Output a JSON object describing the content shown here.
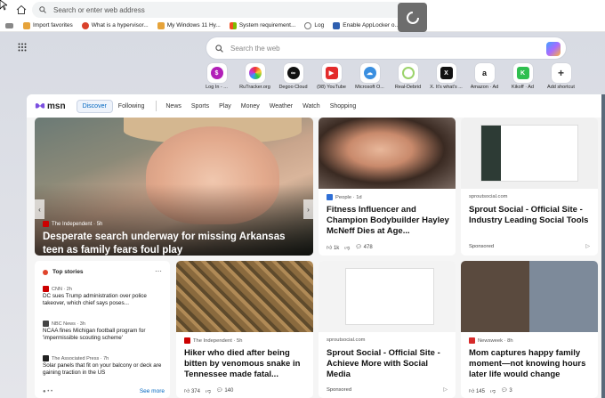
{
  "address_bar": {
    "placeholder": "Search or enter web address"
  },
  "bookmarks": [
    {
      "label": "Import favorites",
      "color": "#e6a33a"
    },
    {
      "label": "What is a hypervisor...",
      "color": "#d9412b"
    },
    {
      "label": "My Windows 11 Hy...",
      "color": "#e6a33a"
    },
    {
      "label": "System requirement...",
      "color": "#3c8d3c"
    },
    {
      "label": "Log",
      "color": "#777777"
    },
    {
      "label": "Enable AppLocker o...",
      "color": "#2e5fb0"
    }
  ],
  "search": {
    "placeholder": "Search the web"
  },
  "shortcuts": [
    {
      "label": "Log In - ...",
      "color": "#b21fb8",
      "glyph": "$"
    },
    {
      "label": "RuTracker.org",
      "color": "#f0f0f0",
      "glyph": "✶"
    },
    {
      "label": "Degoo Cloud",
      "color": "#111111",
      "glyph": "∞"
    },
    {
      "label": "(98) YouTube",
      "color": "#e32b2b",
      "glyph": "▶"
    },
    {
      "label": "Microsoft O...",
      "color": "#3a8fe0",
      "glyph": "☁"
    },
    {
      "label": "Real-Debrid",
      "color": "#f4f4f4",
      "glyph": "◌"
    },
    {
      "label": "X. It's what's ...",
      "color": "#111111",
      "glyph": "X"
    },
    {
      "label": "Amazon · Ad",
      "color": "#ffffff",
      "glyph": "a"
    },
    {
      "label": "Kikoff · Ad",
      "color": "#2fbf4f",
      "glyph": "K"
    },
    {
      "label": "Add shortcut",
      "color": "#ffffff",
      "glyph": "+"
    }
  ],
  "msn": {
    "logo": "msn",
    "tabs_primary": [
      "Discover",
      "Following"
    ],
    "tabs": [
      "News",
      "Sports",
      "Play",
      "Money",
      "Weather",
      "Watch",
      "Shopping"
    ]
  },
  "hero": {
    "source": "The Independent · 5h",
    "title": "Desperate search underway for missing Arkansas teen as family fears foul play",
    "likes": "78",
    "comments": "7"
  },
  "card2": {
    "source": "People · 1d",
    "title": "Fitness Influencer and Champion Bodybuilder Hayley McNeff Dies at Age...",
    "likes": "1k",
    "comments": "478"
  },
  "card3": {
    "source": "sproutsocial.com",
    "title": "Sprout Social - Official Site - Industry Leading Social Tools",
    "sponsored": "Sponsored"
  },
  "top_stories": {
    "heading": "Top stories",
    "items": [
      {
        "source": "CNN · 2h",
        "text": "DC sues Trump administration over police takeover, which chief says poses...",
        "color": "#cc0000"
      },
      {
        "source": "NBC News · 3h",
        "text": "NCAA fines Michigan football program for 'impermissible scouting scheme'",
        "color": "#222222"
      },
      {
        "source": "The Associated Press · 7h",
        "text": "Solar panels that fit on your balcony or deck are gaining traction in the US",
        "color": "#222222"
      }
    ],
    "see_more": "See more"
  },
  "card5": {
    "source": "The Independent · 5h",
    "title": "Hiker who died after being bitten by venomous snake in Tennessee made fatal...",
    "likes": "374",
    "comments": "140"
  },
  "card6": {
    "source": "sproutsocial.com",
    "title": "Sprout Social - Official Site - Achieve More with Social Media",
    "sponsored": "Sponsored"
  },
  "card7": {
    "source": "Newsweek · 8h",
    "title": "Mom captures happy family moment—not knowing hours later life would change",
    "likes": "145",
    "comments": "3"
  }
}
